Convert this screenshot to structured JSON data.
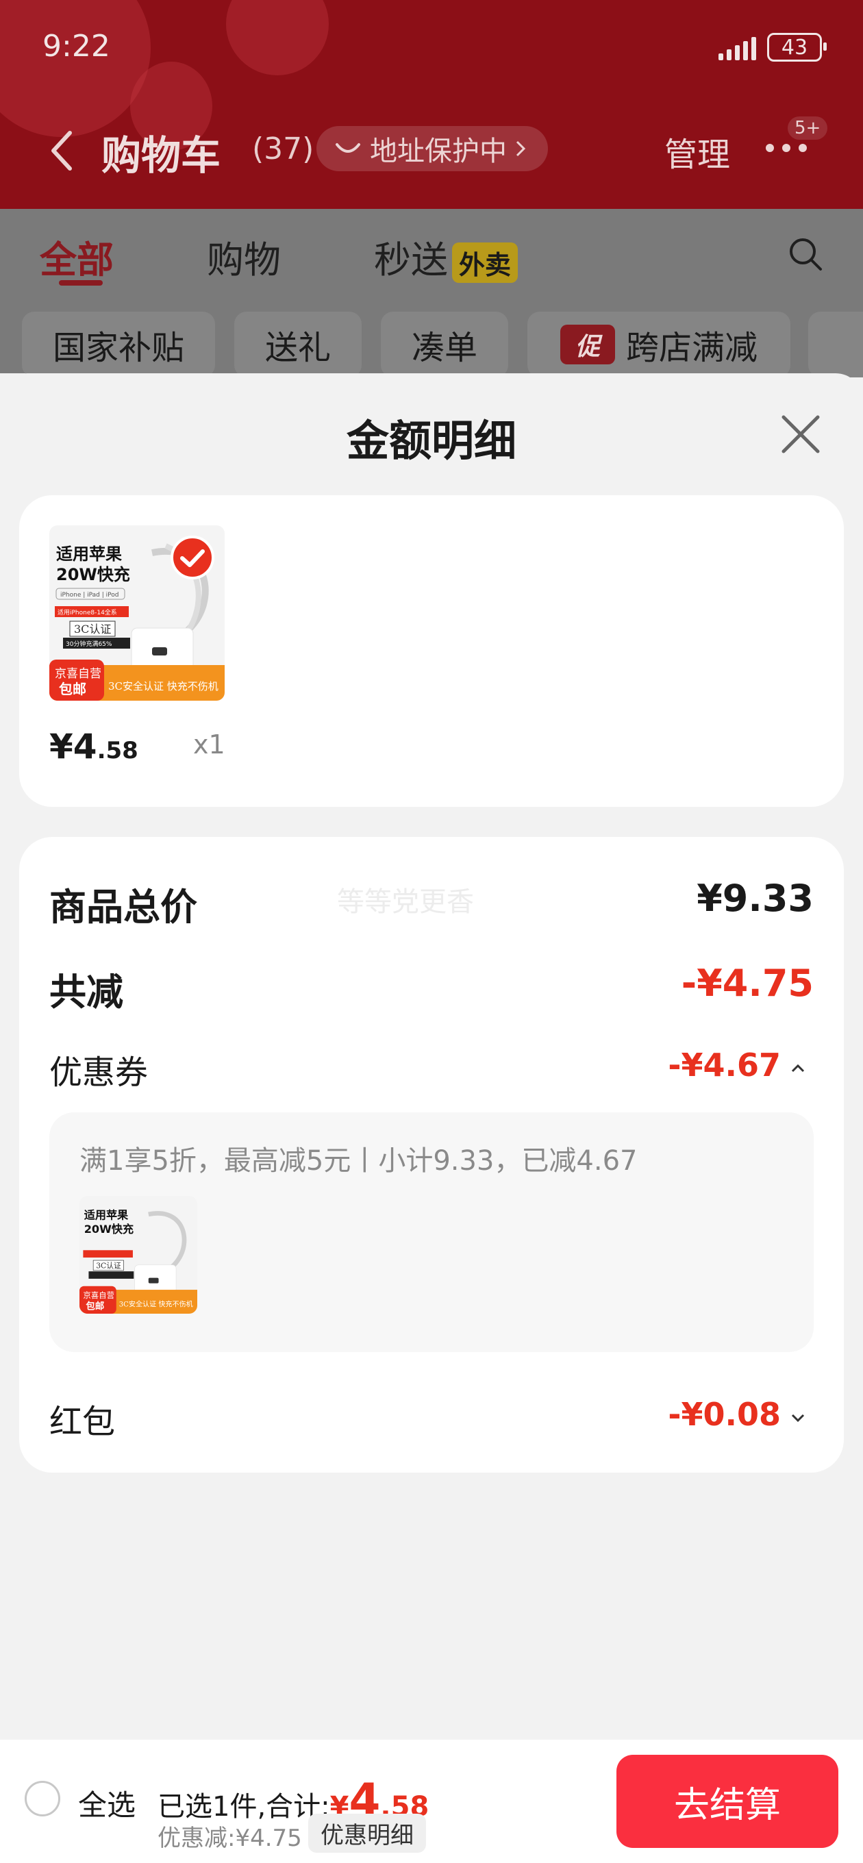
{
  "status_bar": {
    "time": "9:22",
    "battery": "43"
  },
  "header": {
    "title": "购物车",
    "count": "(37)",
    "address_protect": "地址保护中",
    "manage": "管理",
    "more_badge": "5+"
  },
  "tabs": {
    "all": "全部",
    "shopping": "购物",
    "second_delivery": "秒送",
    "waimai_tag": "外卖"
  },
  "chips": {
    "national_subsidy": "国家补贴",
    "gift": "送礼",
    "bundle": "凑单",
    "promo_badge": "促",
    "cross_store": "跨店满减"
  },
  "sheet": {
    "title": "金额明细",
    "item": {
      "image_lines": [
        "适用苹果",
        "20W快充",
        "iPhone | iPad | iPod",
        "适用iPhone8-14全系",
        "3C认证",
        "30分钟充满65%",
        "京喜自营",
        "包邮",
        "3C安全认证 快充不伤机"
      ],
      "price_int": "¥4",
      "price_dec": ".58",
      "qty": "x1"
    },
    "summary": {
      "total_label": "商品总价",
      "watermark": "等等党更香",
      "total_value": "¥9.33",
      "reduce_label": "共减",
      "reduce_value": "-¥4.75",
      "coupon_label": "优惠券",
      "coupon_value": "-¥4.67",
      "coupon_desc": "满1享5折，最高减5元丨小计9.33，已减4.67",
      "redpacket_label": "红包",
      "redpacket_value": "-¥0.08"
    }
  },
  "bottom_bar": {
    "select_all": "全选",
    "selected_prefix": "已选1件,合计:",
    "currency": "¥",
    "total_int": "4",
    "total_dec": ".58",
    "discount": "优惠减:¥4.75",
    "detail": "优惠明细",
    "checkout": "去结算"
  },
  "colors": {
    "accent_red": "#e8301e",
    "checkout_red": "#fa2f3f",
    "header_red": "#8c0f17"
  }
}
